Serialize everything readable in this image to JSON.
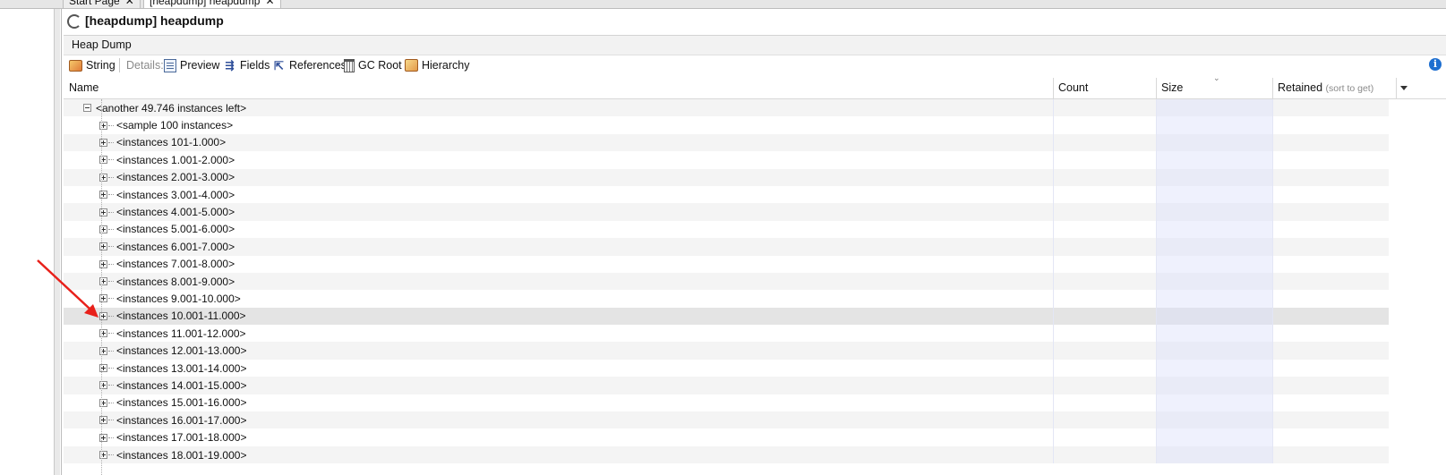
{
  "tabs": [
    {
      "label": "Start Page"
    },
    {
      "label": "[heapdump] heapdump"
    }
  ],
  "window": {
    "title": "[heapdump] heapdump"
  },
  "section": {
    "label": "Heap Dump"
  },
  "toolbar": {
    "string_label": "String",
    "details_label": "Details:",
    "preview_label": "Preview",
    "fields_label": "Fields",
    "references_label": "References",
    "gcroot_label": "GC Root",
    "hierarchy_label": "Hierarchy",
    "info_glyph": "i"
  },
  "table": {
    "columns": {
      "name": "Name",
      "count": "Count",
      "size": "Size",
      "retained": "Retained",
      "retained_hint": "(sort to get)"
    },
    "parent": "<another 49.746 instances left>",
    "rows": [
      "<sample 100 instances>",
      "<instances 101-1.000>",
      "<instances 1.001-2.000>",
      "<instances 2.001-3.000>",
      "<instances 3.001-4.000>",
      "<instances 4.001-5.000>",
      "<instances 5.001-6.000>",
      "<instances 6.001-7.000>",
      "<instances 7.001-8.000>",
      "<instances 8.001-9.000>",
      "<instances 9.001-10.000>",
      "<instances 10.001-11.000>",
      "<instances 11.001-12.000>",
      "<instances 12.001-13.000>",
      "<instances 13.001-14.000>",
      "<instances 14.001-15.000>",
      "<instances 15.001-16.000>",
      "<instances 16.001-17.000>",
      "<instances 17.001-18.000>",
      "<instances 18.001-19.000>"
    ],
    "selected_row": "<instances 10.001-11.000>"
  },
  "colors": {
    "annotation_arrow": "#e8201a",
    "info_icon": "#1e6fd0",
    "selected_row": "#e4e4e4"
  }
}
